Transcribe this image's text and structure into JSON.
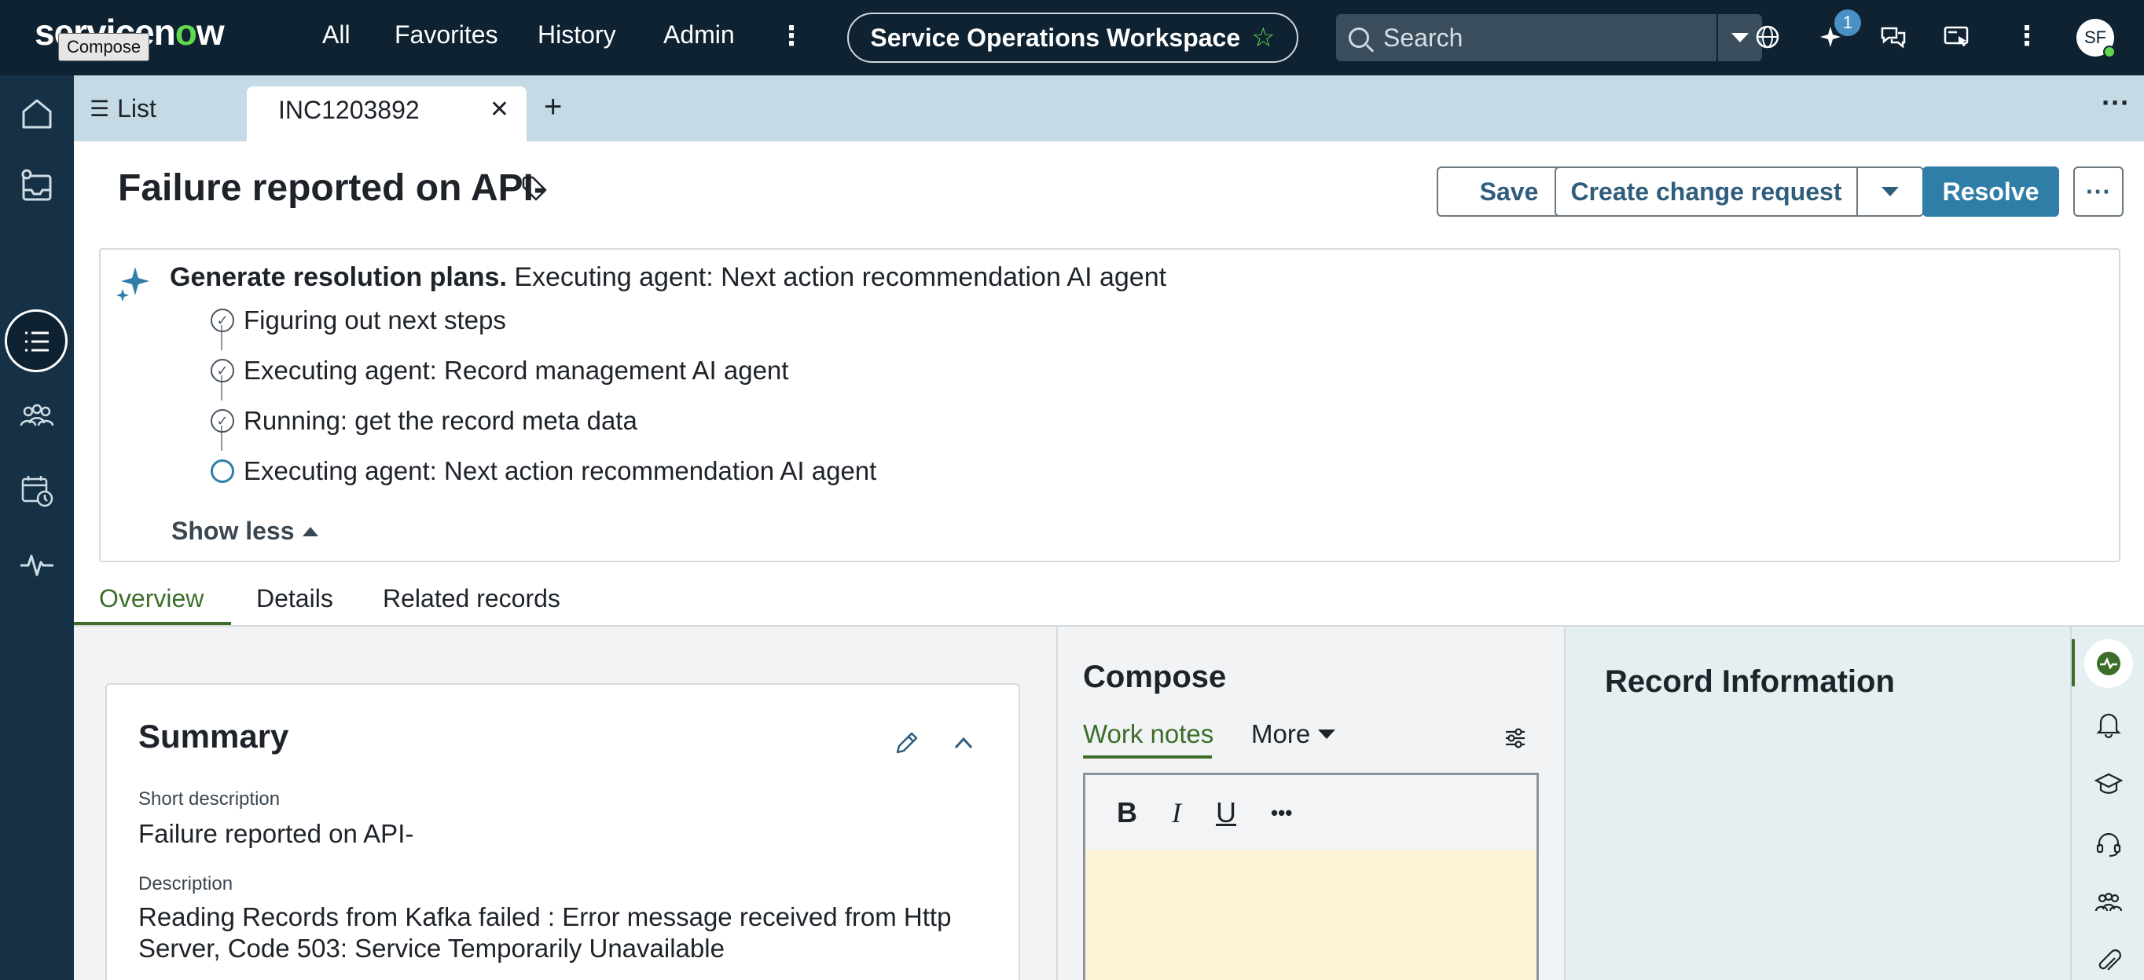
{
  "topbar": {
    "logo_text_a": "servicen",
    "logo_text_o": "o",
    "logo_text_b": "w",
    "tooltip": "Compose",
    "nav": [
      "All",
      "Favorites",
      "History",
      "Admin"
    ],
    "workspace": "Service Operations Workspace",
    "search_placeholder": "Search",
    "notification_count": "1",
    "avatar_initials": "SF"
  },
  "tabs": {
    "list_label": "List",
    "active_label": "INC1203892"
  },
  "record": {
    "title": "Failure reported on API-",
    "buttons": {
      "save": "Save",
      "create_change": "Create change request",
      "resolve": "Resolve"
    }
  },
  "ai_panel": {
    "heading_bold": "Generate resolution plans.",
    "heading_rest": "Executing agent: Next action recommendation AI agent",
    "steps": [
      "Figuring out next steps",
      "Executing agent: Record management AI agent",
      "Running: get the record meta data",
      "Executing agent: Next action recommendation AI agent"
    ],
    "show_less": "Show less"
  },
  "subtabs": [
    "Overview",
    "Details",
    "Related records"
  ],
  "summary": {
    "title": "Summary",
    "short_description_label": "Short description",
    "short_description": "Failure reported on API-",
    "description_label": "Description",
    "description": "Reading Records from Kafka failed : Error message received from Http Server, Code 503: Service Temporarily Unavailable"
  },
  "compose": {
    "title": "Compose",
    "tab_work_notes": "Work notes",
    "tab_more": "More",
    "toolbar": {
      "bold": "B",
      "italic": "I",
      "underline": "U",
      "more": "•••"
    }
  },
  "record_info": {
    "title": "Record Information"
  },
  "colors": {
    "topbar": "#0e2232",
    "accent_green": "#62d84e",
    "primary_button": "#2f7ea8",
    "active_tab_green": "#3c6e2a",
    "editor_bg": "#fdf1d6"
  }
}
